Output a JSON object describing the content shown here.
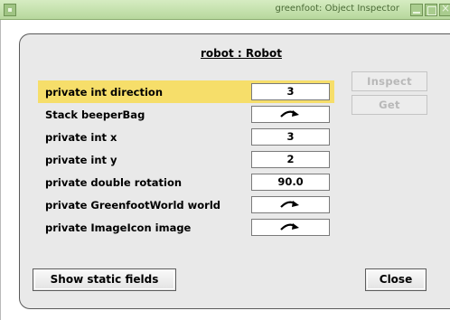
{
  "window": {
    "title": "greenfoot: Object Inspector"
  },
  "inspector": {
    "heading": "robot : Robot",
    "fields": [
      {
        "name": "private int direction",
        "value": "3",
        "selected": true
      },
      {
        "name": "Stack beeperBag",
        "value": "",
        "reference": true
      },
      {
        "name": "private int x",
        "value": "3"
      },
      {
        "name": "private int y",
        "value": "2"
      },
      {
        "name": "private double rotation",
        "value": "90.0"
      },
      {
        "name": "private GreenfootWorld world",
        "value": "",
        "reference": true
      },
      {
        "name": "private ImageIcon image",
        "value": "",
        "reference": true
      }
    ],
    "inspect_label": "Inspect",
    "get_label": "Get",
    "show_static_label": "Show static fields",
    "close_label": "Close"
  },
  "colors": {
    "selection": "#f6de6a",
    "titlebar": "#b7d89d",
    "panel": "#e9e9e9"
  }
}
